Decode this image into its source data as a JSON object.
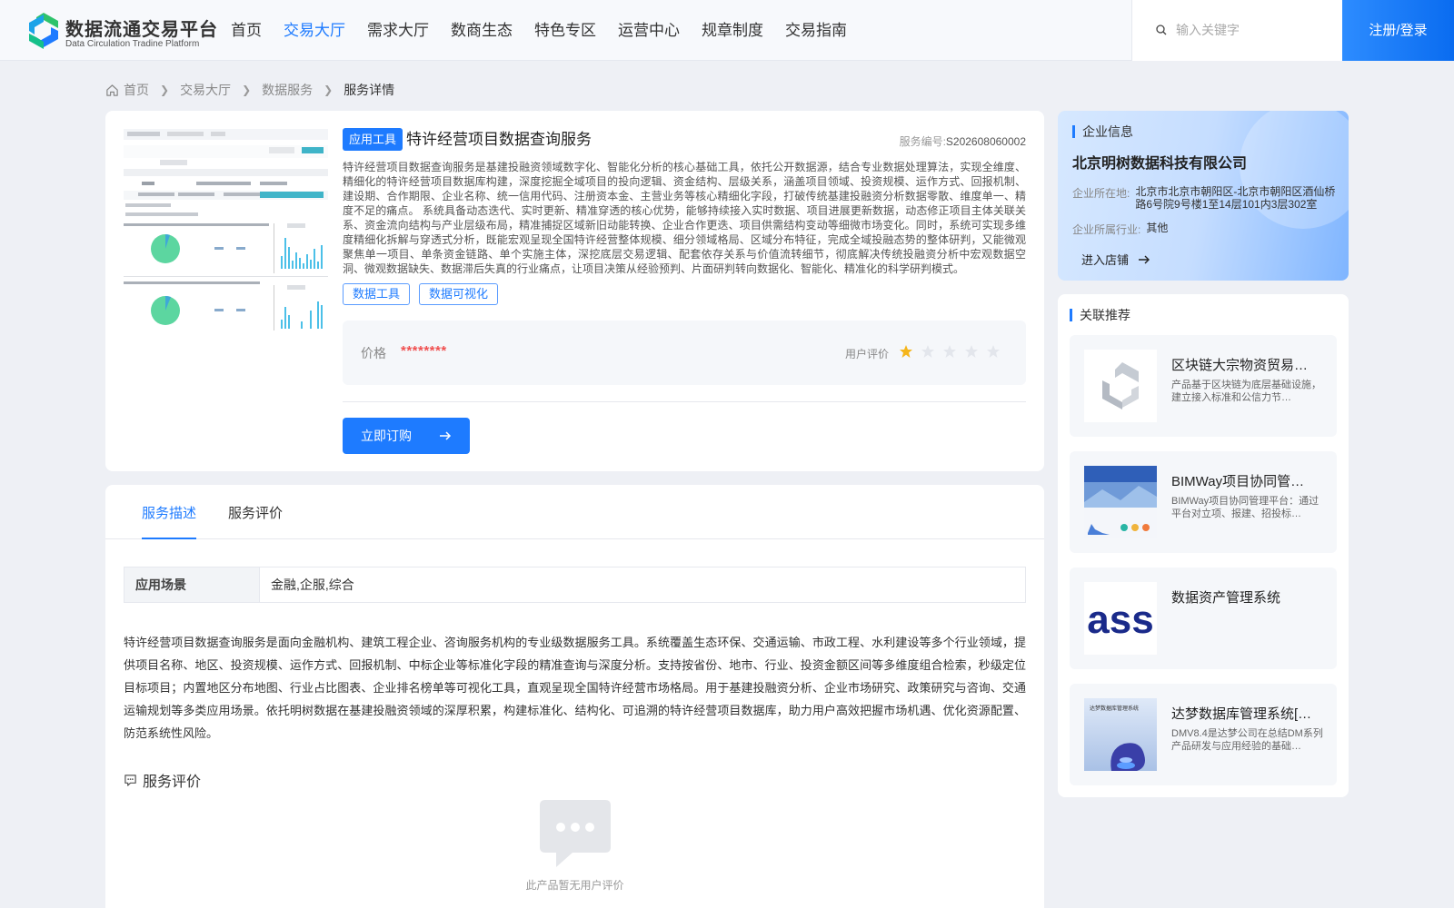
{
  "header": {
    "logo_title": "数据流通交易平台",
    "logo_subtitle": "Data Circulation Tradine Platform",
    "nav": [
      {
        "label": "首页",
        "active": false
      },
      {
        "label": "交易大厅",
        "active": true
      },
      {
        "label": "需求大厅",
        "active": false
      },
      {
        "label": "数商生态",
        "active": false
      },
      {
        "label": "特色专区",
        "active": false
      },
      {
        "label": "运营中心",
        "active": false
      },
      {
        "label": "规章制度",
        "active": false
      },
      {
        "label": "交易指南",
        "active": false
      }
    ],
    "search_placeholder": "输入关键字",
    "login_label": "注册/登录"
  },
  "breadcrumb": [
    "首页",
    "交易大厅",
    "数据服务",
    "服务详情"
  ],
  "product": {
    "type_tag": "应用工具",
    "title": "特许经营项目数据查询服务",
    "service_no_label": "服务编号:",
    "service_no": "S202608060002",
    "description": "特许经营项目数据查询服务是基建投融资领域数字化、智能化分析的核心基础工具，依托公开数据源，结合专业数据处理算法，实现全维度、精细化的特许经营项目数据库构建，深度挖掘全域项目的投向逻辑、资金结构、层级关系，涵盖项目领域、投资规模、运作方式、回报机制、建设期、合作期限、企业名称、统一信用代码、注册资本金、主营业务等核心精细化字段，打破传统基建投融资分析数据零散、维度单一、精度不足的痛点。 系统具备动态迭代、实时更新、精准穿透的核心优势，能够持续接入实时数据、项目进展更新数据，动态修正项目主体关联关系、资金流向结构与产业层级布局，精准捕捉区域新旧动能转换、企业合作更迭、项目供需结构变动等细微市场变化。同时，系统可实现多维度精细化拆解与穿透式分析，既能宏观呈现全国特许经营整体规模、细分领域格局、区域分布特征，完成全域投融态势的整体研判，又能微观聚焦单一项目、单条资金链路、单个实施主体，深挖底层交易逻辑、配套依存关系与价值流转细节，彻底解决传统投融资分析中宏观数据空洞、微观数据缺失、数据滞后失真的行业痛点，让项目决策从经验预判、片面研判转向数据化、智能化、精准化的科学研判模式。",
    "keywords": [
      "数据工具",
      "数据可视化"
    ],
    "price_label": "价格",
    "price_value": "********",
    "rating_label": "用户评价",
    "rating": 1,
    "rating_max": 5,
    "subscribe_label": "立即订购"
  },
  "detail": {
    "tabs": [
      {
        "label": "服务描述",
        "active": true
      },
      {
        "label": "服务评价",
        "active": false
      }
    ],
    "scene_label": "应用场景",
    "scene_value": "金融,企服,综合",
    "long_description": "特许经营项目数据查询服务是面向金融机构、建筑工程企业、咨询服务机构的专业级数据服务工具。系统覆盖生态环保、交通运输、市政工程、水利建设等多个行业领域，提供项目名称、地区、投资规模、运作方式、回报机制、中标企业等标准化字段的精准查询与深度分析。支持按省份、地市、行业、投资金额区间等多维度组合检索，秒级定位目标项目；内置地区分布地图、行业占比图表、企业排名榜单等可视化工具，直观呈现全国特许经营市场格局。用于基建投融资分析、企业市场研究、政策研究与咨询、交通运输规划等多类应用场景。依托明树数据在基建投融资领域的深厚积累，构建标准化、结构化、可追溯的特许经营项目数据库，助力用户高效把握市场机遇、优化资源配置、防范系统性风险。",
    "review_title": "服务评价",
    "empty_text": "此产品暂无用户评价"
  },
  "company": {
    "section_title": "企业信息",
    "name": "北京明树数据科技有限公司",
    "location_label": "企业所在地:",
    "location": "北京市北京市朝阳区-北京市朝阳区酒仙桥路6号院9号楼1至14层101内3层302室",
    "industry_label": "企业所属行业:",
    "industry": "其他",
    "shop_label": "进入店铺"
  },
  "recommend": {
    "section_title": "关联推荐",
    "items": [
      {
        "title": "区块链大宗物资贸易…",
        "desc": "产品基于区块链为底层基础设施，建立接入标准和公信力节…"
      },
      {
        "title": "BIMWay项目协同管…",
        "desc": "BIMWay项目协同管理平台：通过平台对立项、报建、招投标…"
      },
      {
        "title": "数据资产管理系统",
        "desc": ""
      },
      {
        "title": "达梦数据库管理系统[…",
        "desc": "DMV8.4是达梦公司在总结DM系列产品研发与应用经验的基础…"
      }
    ],
    "thumb_texts": [
      "ass",
      "达梦数据库管理系统"
    ]
  },
  "colors": {
    "primary": "#1e7bff",
    "price": "#f05050",
    "star_on": "#f5b51b",
    "star_off": "#e3e6ec",
    "logo_green": "#2ec36b",
    "logo_blue": "#1e7bff"
  }
}
